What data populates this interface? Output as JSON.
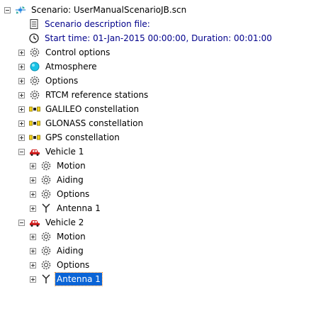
{
  "tree": {
    "root": {
      "label": "Scenario: UserManualScenarioJB.scn",
      "icon": "scenario-satellite-icon"
    },
    "description_file": {
      "label": "Scenario description file:",
      "icon": "document-icon"
    },
    "start_time": {
      "label": "Start time: 01-Jan-2015 00:00:00, Duration: 00:01:00",
      "icon": "clock-icon"
    },
    "top_items": [
      {
        "label": "Control options",
        "icon": "gear-icon"
      },
      {
        "label": "Atmosphere",
        "icon": "atmosphere-icon"
      },
      {
        "label": "Options",
        "icon": "gear-icon"
      },
      {
        "label": "RTCM reference stations",
        "icon": "gear-icon"
      },
      {
        "label": "GALILEO constellation",
        "icon": "constellation-icon"
      },
      {
        "label": "GLONASS constellation",
        "icon": "constellation-icon"
      },
      {
        "label": "GPS constellation",
        "icon": "constellation-icon"
      }
    ],
    "vehicles": [
      {
        "label": "Vehicle 1",
        "icon": "car-icon",
        "children": [
          {
            "label": "Motion",
            "icon": "gear-icon"
          },
          {
            "label": "Aiding",
            "icon": "gear-icon"
          },
          {
            "label": "Options",
            "icon": "gear-icon"
          },
          {
            "label": "Antenna 1",
            "icon": "antenna-icon"
          }
        ]
      },
      {
        "label": "Vehicle 2",
        "icon": "car-icon",
        "children": [
          {
            "label": "Motion",
            "icon": "gear-icon"
          },
          {
            "label": "Aiding",
            "icon": "gear-icon"
          },
          {
            "label": "Options",
            "icon": "gear-icon"
          },
          {
            "label": "Antenna 1",
            "icon": "antenna-icon",
            "selected": true
          }
        ]
      }
    ]
  },
  "colors": {
    "selection": "#0a64d6",
    "info_text": "#00008b",
    "car_red": "#d11f1f",
    "atmosphere_cyan": "#19c3e6",
    "constellation_yellow": "#f2d21b"
  }
}
